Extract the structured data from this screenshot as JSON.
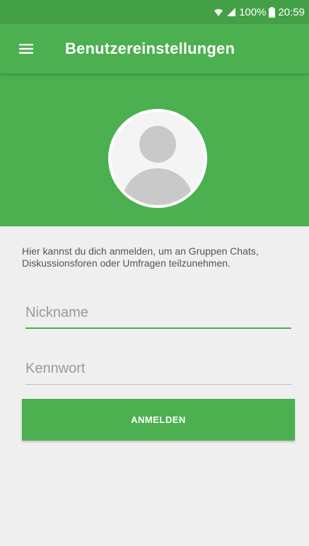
{
  "status_bar": {
    "battery": "100%",
    "time": "20:59",
    "icons": [
      "wifi-icon",
      "signal-icon",
      "battery-icon"
    ]
  },
  "toolbar": {
    "menu_icon": "hamburger-menu-icon",
    "title": "Benutzereinstellungen"
  },
  "profile": {
    "avatar_icon": "default-user-avatar-icon"
  },
  "login_form": {
    "info_text": "Hier kannst du dich anmelden, um an Gruppen Chats, Diskussionsforen oder Umfragen teilzunehmen.",
    "nickname": {
      "value": "",
      "placeholder": "Nickname"
    },
    "password": {
      "value": "",
      "placeholder": "Kennwort"
    },
    "login_label": "ANMELDEN"
  },
  "colors": {
    "primary": "#4caf50",
    "primary_dark": "#43a047",
    "background": "#efefef"
  }
}
